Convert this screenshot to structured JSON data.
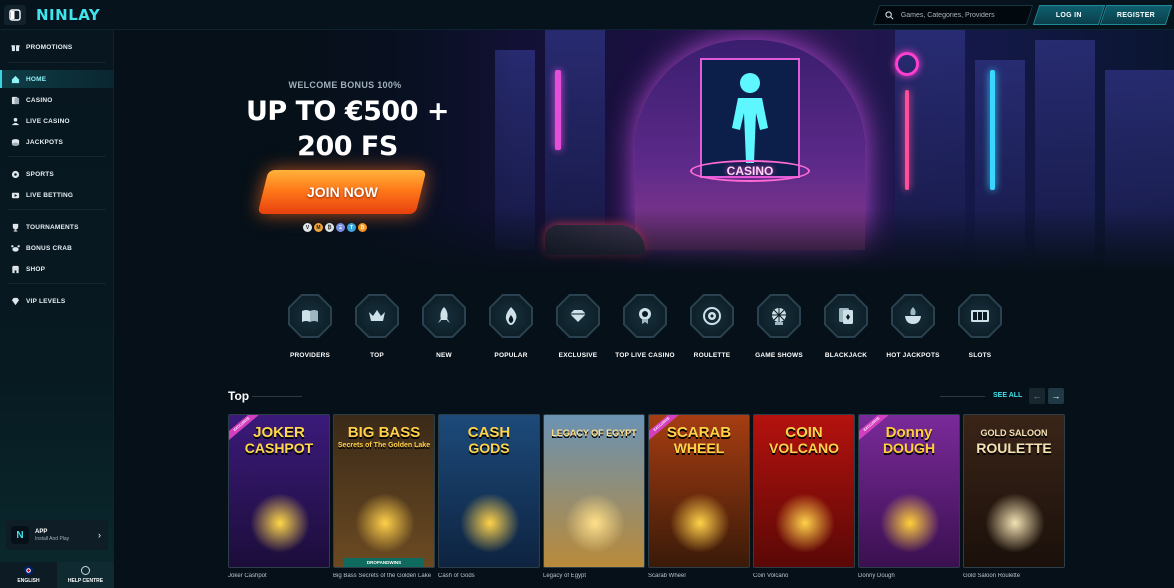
{
  "brand": {
    "logo": "NINLAY",
    "accent": "#3ee3ec"
  },
  "header": {
    "search_placeholder": "Games, Categories, Providers",
    "login_label": "LOG IN",
    "register_label": "REGISTER"
  },
  "sidebar": {
    "items": [
      {
        "label": "PROMOTIONS",
        "icon": "gift-icon"
      },
      {
        "label": "HOME",
        "icon": "home-icon",
        "active": true
      },
      {
        "label": "CASINO",
        "icon": "cards-icon"
      },
      {
        "label": "LIVE CASINO",
        "icon": "dealer-icon"
      },
      {
        "label": "JACKPOTS",
        "icon": "coins-icon"
      },
      {
        "label": "SPORTS",
        "icon": "ball-icon"
      },
      {
        "label": "LIVE BETTING",
        "icon": "live-icon"
      },
      {
        "label": "TOURNAMENTS",
        "icon": "trophy-icon"
      },
      {
        "label": "BONUS CRAB",
        "icon": "crab-icon"
      },
      {
        "label": "SHOP",
        "icon": "shop-icon"
      },
      {
        "label": "VIP LEVELS",
        "icon": "diamond-icon"
      }
    ],
    "app": {
      "title": "APP",
      "subtitle": "Install And Play",
      "logo": "N"
    },
    "bottom": {
      "language": "ENGLISH",
      "help": "HELP CENTRE"
    }
  },
  "hero": {
    "welcome": "WELCOME BONUS 100%",
    "offer_line1": "UP TO €500 +",
    "offer_line2": "200 FS",
    "cta": "JOIN NOW",
    "sign": "CASINO",
    "payments": [
      "V",
      "M",
      "₿",
      "Ξ",
      "T",
      "₿"
    ]
  },
  "categories": [
    {
      "label": "PROVIDERS",
      "icon": "book-icon"
    },
    {
      "label": "TOP",
      "icon": "crown-icon"
    },
    {
      "label": "NEW",
      "icon": "rocket-icon"
    },
    {
      "label": "POPULAR",
      "icon": "flame-icon"
    },
    {
      "label": "EXCLUSIVE",
      "icon": "diamond-icon"
    },
    {
      "label": "TOP LIVE CASINO",
      "icon": "medal-icon"
    },
    {
      "label": "ROULETTE",
      "icon": "roulette-icon"
    },
    {
      "label": "GAME SHOWS",
      "icon": "wheel-icon"
    },
    {
      "label": "BLACKJACK",
      "icon": "card-icon"
    },
    {
      "label": "HOT JACKPOTS",
      "icon": "pot-icon"
    },
    {
      "label": "SLOTS",
      "icon": "slot-icon"
    }
  ],
  "top_section": {
    "title": "Top",
    "see_all": "SEE ALL",
    "prev": "←",
    "next": "→",
    "games": [
      {
        "name": "Joker Cashpot",
        "title": "JOKER",
        "title2": "CASHPOT",
        "bg1": "#3b1a7a",
        "bg2": "#1c0d3a",
        "tc": "#ffd84a",
        "exclusive": true
      },
      {
        "name": "Big Bass Secrets of the Golden Lake",
        "title": "BIG BASS",
        "title2": "Secrets of The Golden Lake",
        "bg1": "#3a2a18",
        "bg2": "#6b4a22",
        "tc": "#ffcf4a",
        "provider": "DROPANDWINS"
      },
      {
        "name": "Cash of Gods",
        "title": "CASH",
        "title2": "GODS",
        "bg1": "#1c4a7a",
        "bg2": "#0e2340",
        "tc": "#ffd24a"
      },
      {
        "name": "Legacy of Egypt",
        "title": "LEGACY OF EGYPT",
        "title2": "",
        "bg1": "#6a92b4",
        "bg2": "#b98a3a",
        "tc": "#ffe08a"
      },
      {
        "name": "Scarab Wheel",
        "title": "SCARAB",
        "title2": "WHEEL",
        "bg1": "#a63d12",
        "bg2": "#3a1a08",
        "tc": "#ffd24a",
        "exclusive": true
      },
      {
        "name": "Coin Volcano",
        "title": "COIN",
        "title2": "VOLCANO",
        "bg1": "#b5120e",
        "bg2": "#5a0806",
        "tc": "#ffd24a"
      },
      {
        "name": "Donny Dough",
        "title": "Donny",
        "title2": "DOUGH",
        "bg1": "#7a2a9a",
        "bg2": "#3a1050",
        "tc": "#ffcf3a",
        "exclusive": true
      },
      {
        "name": "Gold Saloon Roulette",
        "title": "GOLD SALOON",
        "title2": "ROULETTE",
        "bg1": "#3a2418",
        "bg2": "#1a100a",
        "tc": "#f3e2b4"
      }
    ]
  }
}
